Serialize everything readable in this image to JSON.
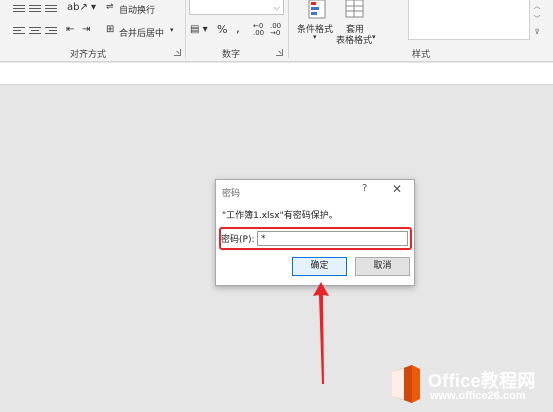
{
  "ribbon": {
    "alignment": {
      "wrap_text": "自动换行",
      "merge_center": "合并后居中",
      "group_label": "对齐方式"
    },
    "number": {
      "format_value": "",
      "percent": "%",
      "comma": ",",
      "inc_decimal": ".00→.0",
      "dec_decimal": ".00→.0",
      "group_label": "数字"
    },
    "styles": {
      "conditional_format_line1": "条件格式",
      "table_format_line1": "套用",
      "table_format_line2": "表格格式",
      "group_label": "样式"
    }
  },
  "dialog": {
    "title": "密码",
    "help": "?",
    "close": "✕",
    "message": "\"工作簿1.xlsx\"有密码保护。",
    "password_label": "密码(P):",
    "password_value": "*",
    "ok_label": "确定",
    "cancel_label": "取消"
  },
  "watermark": {
    "brand": "Office教程网",
    "url": "www.office26.com"
  },
  "colors": {
    "highlight": "#e8242a",
    "arrow": "#e8242a",
    "ok_border": "#0078d7",
    "logo_orange": "#ea5b0c"
  }
}
